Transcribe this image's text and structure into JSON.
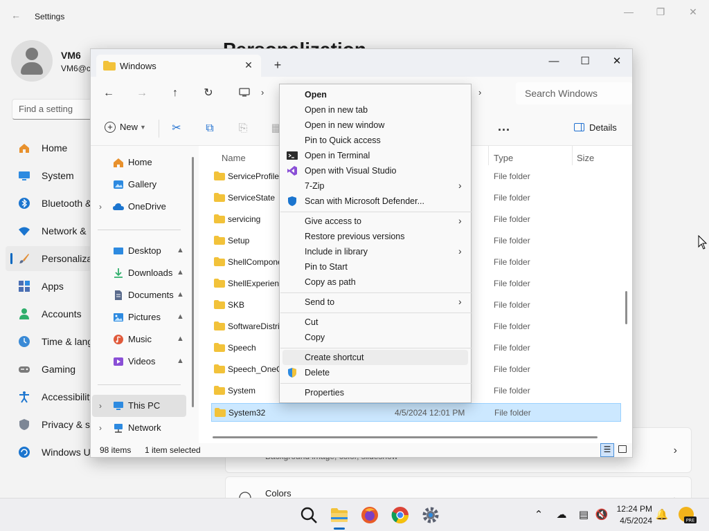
{
  "settings": {
    "title": "Settings",
    "user": {
      "name": "VM6",
      "email": "VM6@c"
    },
    "search_placeholder": "Find a setting",
    "page_heading": "Personalization",
    "nav": [
      {
        "label": "Home"
      },
      {
        "label": "System"
      },
      {
        "label": "Bluetooth &"
      },
      {
        "label": "Network &"
      },
      {
        "label": "Personaliza"
      },
      {
        "label": "Apps"
      },
      {
        "label": "Accounts"
      },
      {
        "label": "Time & lang"
      },
      {
        "label": "Gaming"
      },
      {
        "label": "Accessibility"
      },
      {
        "label": "Privacy & s"
      },
      {
        "label": "Windows U"
      }
    ],
    "cards": [
      {
        "subtitle": "Background image, color, slideshow"
      },
      {
        "title": "Colors"
      }
    ]
  },
  "explorer": {
    "tab_title": "Windows",
    "search_placeholder": "Search Windows",
    "toolbar": {
      "new_label": "New",
      "details_label": "Details",
      "more_label": "..."
    },
    "nav_pane": {
      "top": [
        {
          "label": "Home"
        },
        {
          "label": "Gallery"
        },
        {
          "label": "OneDrive"
        }
      ],
      "quick": [
        {
          "label": "Desktop"
        },
        {
          "label": "Downloads"
        },
        {
          "label": "Documents"
        },
        {
          "label": "Pictures"
        },
        {
          "label": "Music"
        },
        {
          "label": "Videos"
        }
      ],
      "bottom": [
        {
          "label": "This PC"
        },
        {
          "label": "Network"
        }
      ]
    },
    "columns": {
      "name": "Name",
      "type": "Type",
      "size": "Size"
    },
    "rows": [
      {
        "name": "ServiceProfiles",
        "date": "",
        "type": "File folder"
      },
      {
        "name": "ServiceState",
        "date": "",
        "type": "File folder"
      },
      {
        "name": "servicing",
        "date": "",
        "type": "File folder"
      },
      {
        "name": "Setup",
        "date": "",
        "type": "File folder"
      },
      {
        "name": "ShellComponents",
        "date": "",
        "type": "File folder"
      },
      {
        "name": "ShellExperiences",
        "date": "",
        "type": "File folder"
      },
      {
        "name": "SKB",
        "date": "",
        "type": "File folder"
      },
      {
        "name": "SoftwareDistribution",
        "date": "",
        "type": "File folder"
      },
      {
        "name": "Speech",
        "date": "",
        "type": "File folder"
      },
      {
        "name": "Speech_OneCore",
        "date": "",
        "type": "File folder"
      },
      {
        "name": "System",
        "date": "",
        "type": "File folder"
      },
      {
        "name": "System32",
        "date": "4/5/2024 12:01 PM",
        "type": "File folder"
      }
    ],
    "status": {
      "count": "98 items",
      "selected": "1 item selected"
    }
  },
  "context_menu": {
    "items": [
      {
        "label": "Open"
      },
      {
        "label": "Open in new tab"
      },
      {
        "label": "Open in new window"
      },
      {
        "label": "Pin to Quick access"
      },
      {
        "label": "Open in Terminal"
      },
      {
        "label": "Open with Visual Studio"
      },
      {
        "label": "7-Zip"
      },
      {
        "label": "Scan with Microsoft Defender..."
      },
      {
        "label": "Give access to"
      },
      {
        "label": "Restore previous versions"
      },
      {
        "label": "Include in library"
      },
      {
        "label": "Pin to Start"
      },
      {
        "label": "Copy as path"
      },
      {
        "label": "Send to"
      },
      {
        "label": "Cut"
      },
      {
        "label": "Copy"
      },
      {
        "label": "Create shortcut"
      },
      {
        "label": "Delete"
      },
      {
        "label": "Properties"
      }
    ]
  },
  "taskbar": {
    "time": "12:24 PM",
    "date": "4/5/2024",
    "badge": "PRE"
  },
  "colors": {
    "accent": "#0067c0",
    "folder": "#f2c23a",
    "selection": "#cce8ff"
  }
}
